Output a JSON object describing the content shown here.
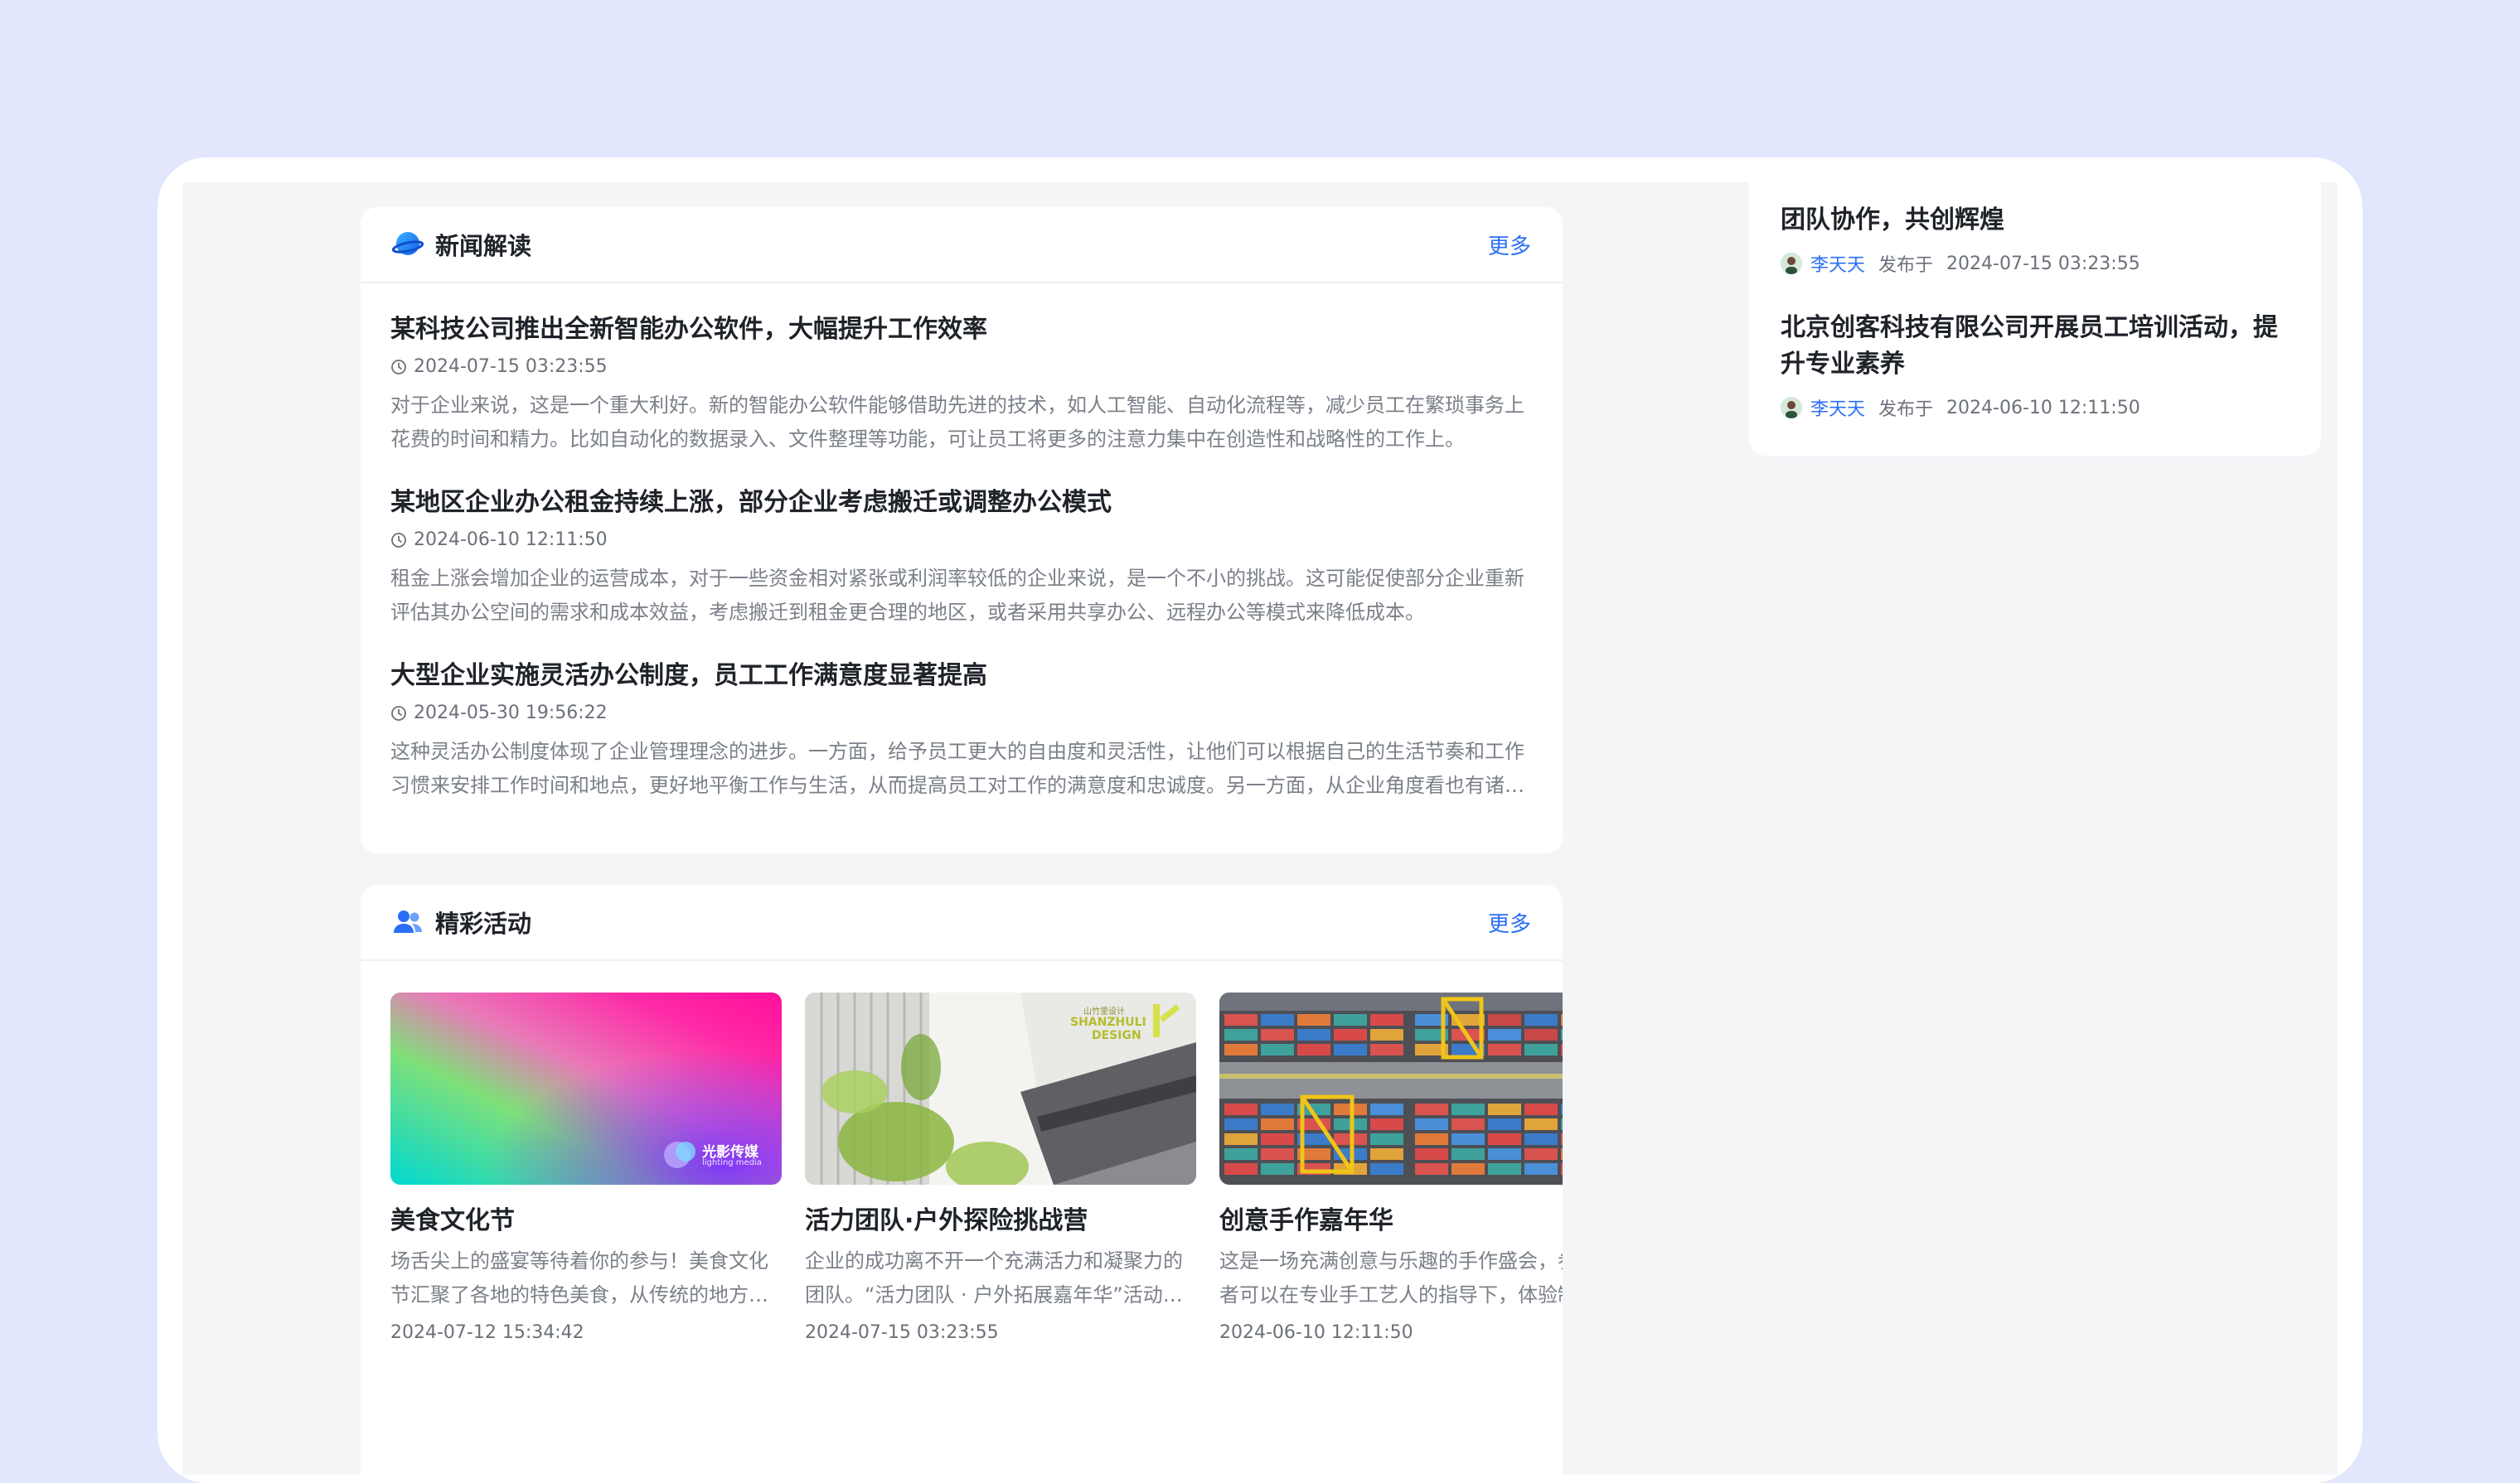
{
  "news": {
    "title": "新闻解读",
    "more": "更多",
    "items": [
      {
        "title": "某科技公司推出全新智能办公软件，大幅提升工作效率",
        "time": "2024-07-15 03:23:55",
        "desc": "对于企业来说，这是一个重大利好。新的智能办公软件能够借助先进的技术，如人工智能、自动化流程等，减少员工在繁琐事务上花费的时间和精力。比如自动化的数据录入、文件整理等功能，可让员工将更多的注意力集中在创造性和战略性的工作上。"
      },
      {
        "title": "某地区企业办公租金持续上涨，部分企业考虑搬迁或调整办公模式",
        "time": "2024-06-10 12:11:50",
        "desc": "租金上涨会增加企业的运营成本，对于一些资金相对紧张或利润率较低的企业来说，是一个不小的挑战。这可能促使部分企业重新评估其办公空间的需求和成本效益，考虑搬迁到租金更合理的地区，或者采用共享办公、远程办公等模式来降低成本。"
      },
      {
        "title": "大型企业实施灵活办公制度，员工工作满意度显著提高",
        "time": "2024-05-30 19:56:22",
        "desc": "这种灵活办公制度体现了企业管理理念的进步。一方面，给予员工更大的自由度和灵活性，让他们可以根据自己的生活节奏和工作习惯来安排工作时间和地点，更好地平衡工作与生活，从而提高员工对工作的满意度和忠诚度。另一方面，从企业角度看也有诸多好处。"
      }
    ]
  },
  "activities": {
    "title": "精彩活动",
    "more": "更多",
    "items": [
      {
        "title": "美食文化节",
        "desc": "场舌尖上的盛宴等待着你的参与！美食文化节汇聚了各地的特色美食，从传统的地方小吃到精致的异国料理。",
        "time": "2024-07-12 15:34:42",
        "logo_text": "光影传媒",
        "logo_sub": "lighting media"
      },
      {
        "title": "活力团队·户外探险挑战营",
        "desc": "企业的成功离不开一个充满活力和凝聚力的团队。“活力团队 · 户外拓展嘉年华”活动由此而来。",
        "time": "2024-07-15 03:23:55",
        "brand_cn": "山竹里设计",
        "brand_en1": "SHANZHULI",
        "brand_en2": "DESIGN"
      },
      {
        "title": "创意手作嘉年华",
        "desc": "这是一场充满创意与乐趣的手作盛会，参与者可以在专业手工艺人的指导下，体验制作的乐趣。",
        "time": "2024-06-10 12:11:50"
      }
    ]
  },
  "side": {
    "items": [
      {
        "title": "团队协作，共创辉煌",
        "author": "李天天",
        "published": "发布于",
        "time": "2024-07-15 03:23:55"
      },
      {
        "title": "北京创客科技有限公司开展员工培训活动，提升专业素养",
        "author": "李天天",
        "published": "发布于",
        "time": "2024-06-10 12:11:50"
      }
    ]
  },
  "colors": {
    "background": "#e2e7fe",
    "accent": "#2b6ff6"
  }
}
